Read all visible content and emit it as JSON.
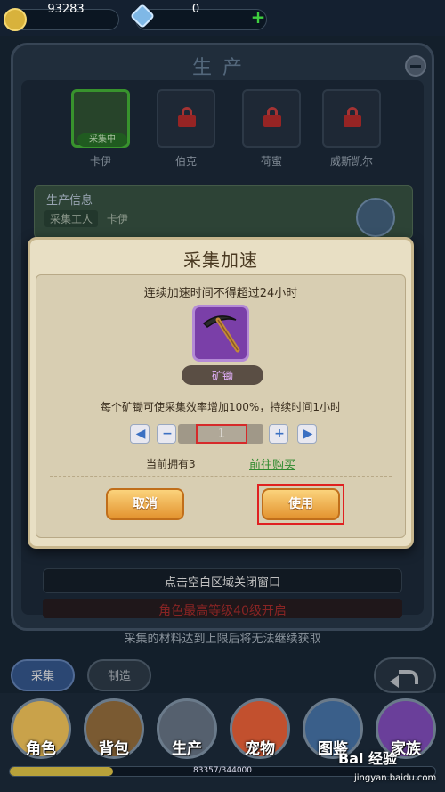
{
  "currency": {
    "gold": "93283",
    "gems": "0",
    "add_symbol": "+"
  },
  "panel": {
    "title": "生产",
    "workers": [
      {
        "name": "卡伊",
        "status": "采集中",
        "locked": false
      },
      {
        "name": "伯克",
        "locked": true
      },
      {
        "name": "荷蜜",
        "locked": true
      },
      {
        "name": "威斯凯尔",
        "locked": true
      }
    ],
    "info": {
      "title": "生产信息",
      "worker_label": "采集工人",
      "worker_value": "卡伊"
    },
    "close_hint": "点击空白区域关闭窗口",
    "level_notice": "角色最高等级40级开启",
    "limit_text": "采集的材料达到上限后将无法继续获取"
  },
  "dialog": {
    "title": "采集加速",
    "limit_note": "连续加速时间不得超过24小时",
    "item_name": "矿锄",
    "effect": "每个矿锄可使采集效率增加100%，持续时间1小时",
    "quantity": "1",
    "owned": "当前拥有3",
    "buy_link": "前往购买",
    "cancel_label": "取消",
    "use_label": "使用"
  },
  "tabs": {
    "collect": "采集",
    "craft": "制造"
  },
  "nav": [
    {
      "label": "角色",
      "icon": "character-icon",
      "color": "#c9a24a"
    },
    {
      "label": "背包",
      "icon": "backpack-icon",
      "color": "#7a5a32"
    },
    {
      "label": "生产",
      "icon": "production-icon",
      "color": "#55606e"
    },
    {
      "label": "宠物",
      "icon": "pet-icon",
      "color": "#c2502e"
    },
    {
      "label": "图鉴",
      "icon": "codex-icon",
      "color": "#3a5f8a"
    },
    {
      "label": "家族",
      "icon": "family-icon",
      "color": "#6a3f9a"
    }
  ],
  "exp": {
    "text": "83357/344000",
    "fraction": 0.242
  },
  "watermark": {
    "logo": "Bai 经验",
    "url": "jingyan.baidu.com"
  }
}
